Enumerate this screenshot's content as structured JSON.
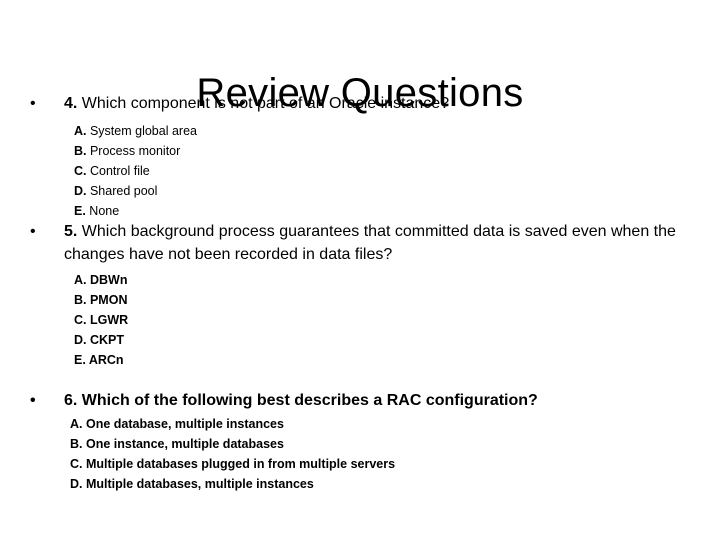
{
  "slide": {
    "title": "Review Questions",
    "bullet_glyph": "•",
    "questions": [
      {
        "number": "4.",
        "text": " Which component is not part of an Oracle instance?",
        "options": [
          {
            "letter": "A.",
            "text": " System global area"
          },
          {
            "letter": "B.",
            "text": " Process monitor"
          },
          {
            "letter": "C.",
            "text": " Control file"
          },
          {
            "letter": "D.",
            "text": " Shared pool"
          },
          {
            "letter": "E.",
            "text": " None"
          }
        ]
      },
      {
        "number": "5.",
        "text": " Which background process guarantees that committed data is saved even when the changes have not been recorded in data files?",
        "options": [
          {
            "letter": "A.",
            "text": " DBWn"
          },
          {
            "letter": "B.",
            "text": " PMON"
          },
          {
            "letter": "C.",
            "text": " LGWR"
          },
          {
            "letter": "D.",
            "text": " CKPT"
          },
          {
            "letter": "E.",
            "text": " ARCn"
          }
        ]
      },
      {
        "number": "6.",
        "text": " Which of the following best describes a RAC configuration?",
        "options": [
          {
            "letter": "A.",
            "text": " One database, multiple instances"
          },
          {
            "letter": "B.",
            "text": " One instance, multiple databases"
          },
          {
            "letter": "C.",
            "text": " Multiple databases plugged in from multiple servers"
          },
          {
            "letter": "D.",
            "text": " Multiple databases, multiple instances"
          }
        ]
      }
    ]
  }
}
